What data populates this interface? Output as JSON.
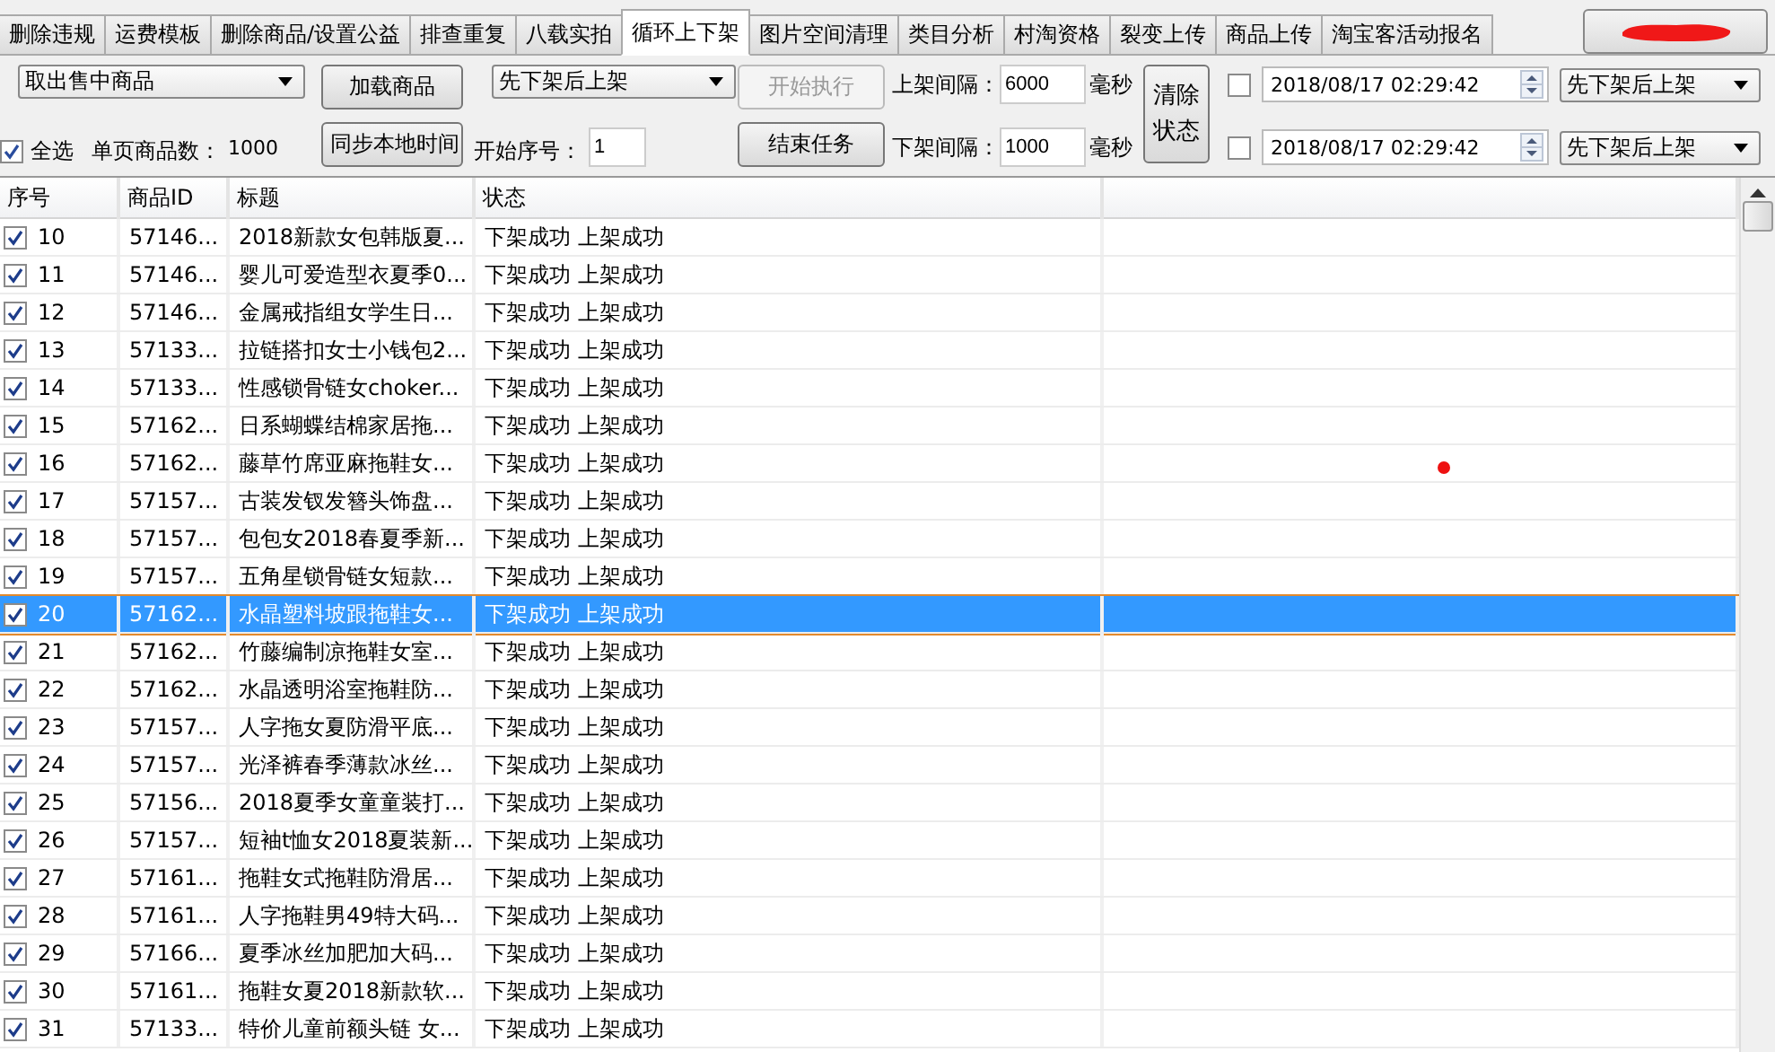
{
  "tabs": [
    {
      "label": "删除违规",
      "selected": false
    },
    {
      "label": "运费模板",
      "selected": false
    },
    {
      "label": "删除商品/设置公益",
      "selected": false
    },
    {
      "label": "排查重复",
      "selected": false
    },
    {
      "label": "八载实拍",
      "selected": false
    },
    {
      "label": "循环上下架",
      "selected": true
    },
    {
      "label": "图片空间清理",
      "selected": false
    },
    {
      "label": "类目分析",
      "selected": false
    },
    {
      "label": "村淘资格",
      "selected": false
    },
    {
      "label": "裂变上传",
      "selected": false
    },
    {
      "label": "商品上传",
      "selected": false
    },
    {
      "label": "淘宝客活动报名",
      "selected": false
    }
  ],
  "account_button": {
    "redacted": true
  },
  "controls": {
    "source_dropdown": "取出售中商品",
    "select_all": {
      "label": "全选",
      "checked": true
    },
    "page_count_label": "单页商品数：",
    "page_count": "1000",
    "load_button": "加载商品",
    "sync_time_button": "同步本地时间",
    "mode_dropdown": "先下架后上架",
    "start_index_label": "开始序号：",
    "start_index": "1",
    "start_button": {
      "label": "开始执行",
      "disabled": true
    },
    "stop_button": {
      "label": "结束任务",
      "disabled": false
    },
    "listing_interval": {
      "label": "上架间隔：",
      "value": "6000",
      "unit": "毫秒"
    },
    "delisting_interval": {
      "label": "下架间隔：",
      "value": "1000",
      "unit": "毫秒"
    },
    "clear_button": "清除状态",
    "schedules": [
      {
        "checked": false,
        "datetime": "2018/08/17 02:29:42",
        "mode": "先下架后上架"
      },
      {
        "checked": false,
        "datetime": "2018/08/17 02:29:42",
        "mode": "先下架后上架"
      }
    ]
  },
  "table": {
    "columns": [
      "序号",
      "商品ID",
      "标题",
      "状态"
    ],
    "rows": [
      {
        "checked": true,
        "index": "10",
        "id": "57146...",
        "title": "2018新款女包韩版夏...",
        "status": "下架成功 上架成功",
        "selected": false
      },
      {
        "checked": true,
        "index": "11",
        "id": "57146...",
        "title": "婴儿可爱造型衣夏季0...",
        "status": "下架成功 上架成功",
        "selected": false
      },
      {
        "checked": true,
        "index": "12",
        "id": "57146...",
        "title": "金属戒指组女学生日...",
        "status": "下架成功 上架成功",
        "selected": false
      },
      {
        "checked": true,
        "index": "13",
        "id": "57133...",
        "title": "拉链搭扣女士小钱包2...",
        "status": "下架成功 上架成功",
        "selected": false
      },
      {
        "checked": true,
        "index": "14",
        "id": "57133...",
        "title": "性感锁骨链女choker...",
        "status": "下架成功 上架成功",
        "selected": false
      },
      {
        "checked": true,
        "index": "15",
        "id": "57162...",
        "title": "日系蝴蝶结棉家居拖...",
        "status": "下架成功 上架成功",
        "selected": false
      },
      {
        "checked": true,
        "index": "16",
        "id": "57162...",
        "title": "藤草竹席亚麻拖鞋女...",
        "status": "下架成功 上架成功",
        "selected": false
      },
      {
        "checked": true,
        "index": "17",
        "id": "57157...",
        "title": "古装发钗发簪头饰盘...",
        "status": "下架成功 上架成功",
        "selected": false
      },
      {
        "checked": true,
        "index": "18",
        "id": "57157...",
        "title": "包包女2018春夏季新...",
        "status": "下架成功 上架成功",
        "selected": false
      },
      {
        "checked": true,
        "index": "19",
        "id": "57157...",
        "title": "五角星锁骨链女短款...",
        "status": "下架成功 上架成功",
        "selected": false
      },
      {
        "checked": true,
        "index": "20",
        "id": "57162...",
        "title": "水晶塑料坡跟拖鞋女...",
        "status": "下架成功 上架成功",
        "selected": true
      },
      {
        "checked": true,
        "index": "21",
        "id": "57162...",
        "title": "竹藤编制凉拖鞋女室...",
        "status": "下架成功 上架成功",
        "selected": false
      },
      {
        "checked": true,
        "index": "22",
        "id": "57162...",
        "title": "水晶透明浴室拖鞋防...",
        "status": "下架成功 上架成功",
        "selected": false
      },
      {
        "checked": true,
        "index": "23",
        "id": "57157...",
        "title": "人字拖女夏防滑平底...",
        "status": "下架成功 上架成功",
        "selected": false
      },
      {
        "checked": true,
        "index": "24",
        "id": "57157...",
        "title": "光泽裤春季薄款冰丝...",
        "status": "下架成功 上架成功",
        "selected": false
      },
      {
        "checked": true,
        "index": "25",
        "id": "57156...",
        "title": "2018夏季女童童装打...",
        "status": "下架成功 上架成功",
        "selected": false
      },
      {
        "checked": true,
        "index": "26",
        "id": "57157...",
        "title": "短袖t恤女2018夏装新...",
        "status": "下架成功 上架成功",
        "selected": false
      },
      {
        "checked": true,
        "index": "27",
        "id": "57161...",
        "title": "拖鞋女式拖鞋防滑居...",
        "status": "下架成功 上架成功",
        "selected": false
      },
      {
        "checked": true,
        "index": "28",
        "id": "57161...",
        "title": "人字拖鞋男49特大码...",
        "status": "下架成功 上架成功",
        "selected": false
      },
      {
        "checked": true,
        "index": "29",
        "id": "57166...",
        "title": "夏季冰丝加肥加大码...",
        "status": "下架成功 上架成功",
        "selected": false
      },
      {
        "checked": true,
        "index": "30",
        "id": "57161...",
        "title": "拖鞋女夏2018新款软...",
        "status": "下架成功 上架成功",
        "selected": false
      },
      {
        "checked": true,
        "index": "31",
        "id": "57133...",
        "title": "特价儿童前额头链 女...",
        "status": "下架成功 上架成功",
        "selected": false
      }
    ]
  },
  "cursor_dot": {
    "shown": true
  }
}
